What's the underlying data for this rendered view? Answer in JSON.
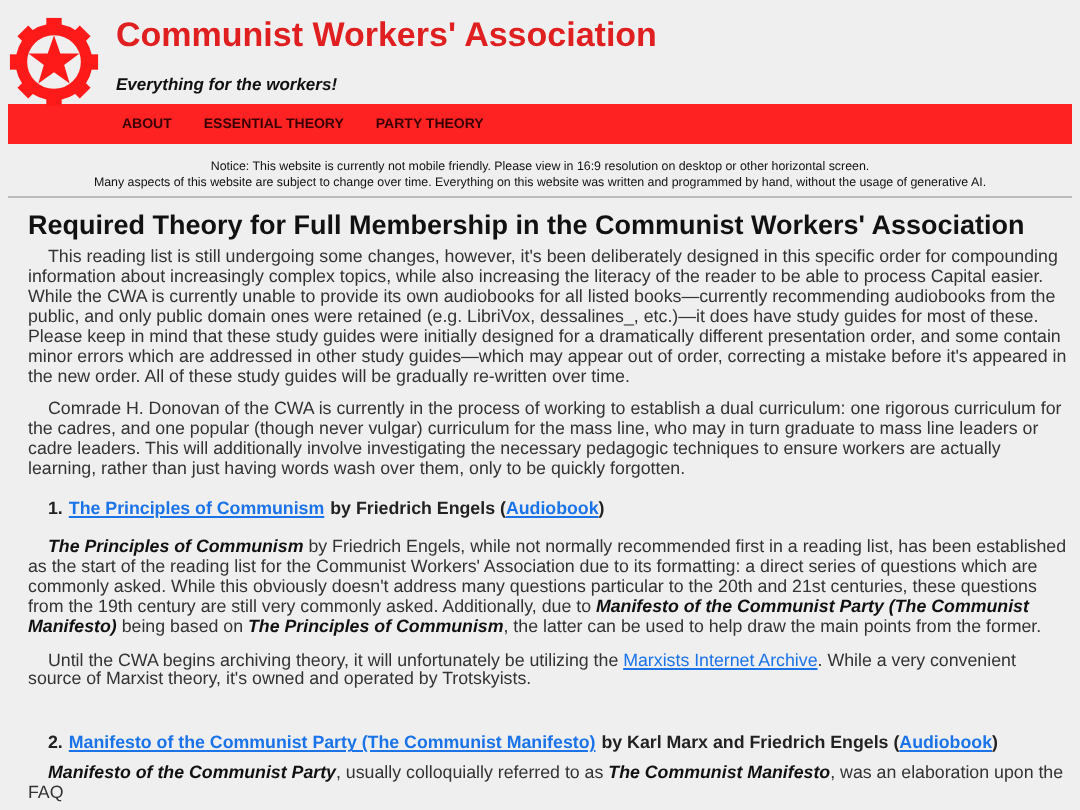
{
  "header": {
    "title": "Communist Workers' Association",
    "tagline": "Everything for the workers!"
  },
  "nav": [
    {
      "label": "ABOUT"
    },
    {
      "label": "ESSENTIAL THEORY"
    },
    {
      "label": "PARTY THEORY"
    }
  ],
  "notice": [
    "Notice: This website is currently not mobile friendly. Please view in 16:9 resolution on desktop or other horizontal screen.",
    "Many aspects of this website are subject to change over time. Everything on this website was written and programmed by hand, without the usage of generative AI."
  ],
  "heading": "Required Theory for Full Membership in the Communist Workers' Association",
  "intro": [
    {
      "text": "This reading list is still undergoing some changes, however, it's been deliberately designed in this specific order for compounding information about increasingly complex topics, while also increasing the literacy of the reader to be able to process Capital easier. While the CWA is currently unable to provide its own audiobooks for all listed books—currently recommending audiobooks from the public, and only public domain ones were retained (e.g. LibriVox, dessalines_, etc.)—it does have study guides for most of these. Please keep in mind that these study guides were initially designed for a dramatically different presentation order, and some contain minor errors which are addressed in other study guides—which may appear out of order, correcting a mistake before it's appeared in the new order. All of these study guides will be gradually re-written over time."
    },
    {
      "text": "Comrade H. Donovan of the CWA is currently in the process of working to establish a dual curriculum: one rigorous curriculum for the cadres, and one popular (though never vulgar) curriculum for the mass line, who may in turn graduate to mass line leaders or cadre leaders. This will additionally involve investigating the necessary pedagogic techniques to ensure workers are actually learning, rather than just having words wash over them, only to be quickly forgotten."
    }
  ],
  "readings": [
    {
      "number": "1.",
      "title": "The Principles of Communism",
      "author": "by Friedrich Engels (",
      "audio": "Audiobook",
      "close": ")",
      "paragraphs": [
        {
          "text": "**The Principles of Communism** by Friedrich Engels, while not normally recommended first in a reading list, has been established as the start of the reading list for the Communist Workers' Association due to its formatting: a direct series of questions which are commonly asked. While this obviously doesn't address many questions particular to the 20th and 21st centuries, these questions from the 19th century are still very commonly asked. Additionally, due to **Manifesto of the Communist Party (The Communist Manifesto)** being based on **The Principles of Communism**, the latter can be used to help draw the main points from the former."
        },
        {
          "text": "Until the CWA begins archiving theory, it will unfortunately be utilizing the ",
          "link": "Marxists Internet Archive",
          "after": ". While a very convenient source of Marxist theory, it's owned and operated by Trotskyists."
        }
      ]
    },
    {
      "number": "2.",
      "title": "Manifesto of the Communist Party (The Communist Manifesto)",
      "author": "by Karl Marx and Friedrich Engels (",
      "audio": "Audiobook",
      "close": ")",
      "paragraphs": [
        {
          "text": "**Manifesto of the Communist Party**, usually colloquially referred to as **The Communist Manifesto**, was an elaboration upon the FAQ"
        }
      ]
    }
  ]
}
